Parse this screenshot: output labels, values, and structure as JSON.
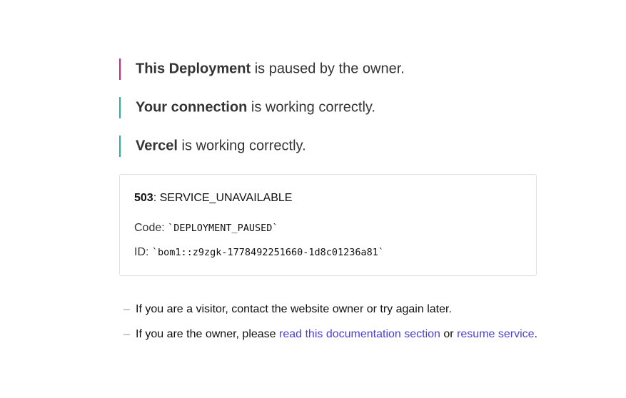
{
  "status_lines": [
    {
      "strong": "This Deployment",
      "rest": " is paused by the owner.",
      "color": "#d6247f"
    },
    {
      "strong": "Your connection",
      "rest": " is working correctly.",
      "color": "#2bb39a"
    },
    {
      "strong": "Vercel",
      "rest": " is working correctly.",
      "color": "#2bb39a"
    }
  ],
  "error": {
    "status_code": "503",
    "status_text": ": SERVICE_UNAVAILABLE",
    "code_label": "Code: ",
    "code_value": "`DEPLOYMENT_PAUSED`",
    "id_label": "ID: ",
    "id_value": "`bom1::z9zgk-1778492251660-1d8c01236a81`"
  },
  "help": {
    "dash": "–",
    "visitor_text": "If you are a visitor, contact the website owner or try again later.",
    "owner_prefix": "If you are the owner, please ",
    "docs_link": "read this documentation section",
    "owner_middle": " or ",
    "resume_link": "resume service",
    "owner_suffix": "."
  },
  "colors": {
    "link": "#4a3fd8",
    "paused_accent": "#d6247f",
    "ok_accent": "#2bb39a"
  }
}
